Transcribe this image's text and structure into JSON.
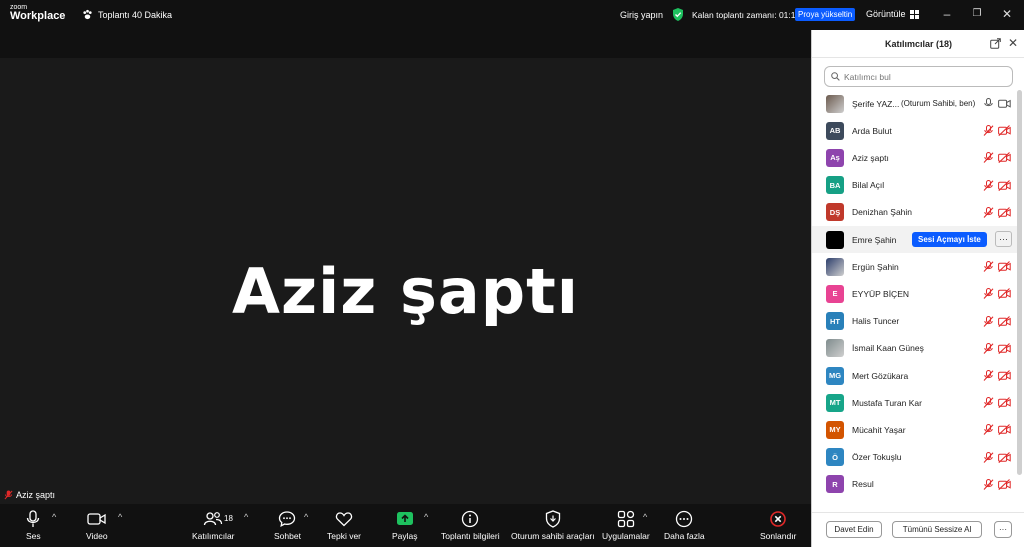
{
  "titlebar": {
    "logo_top": "zoom",
    "logo_bottom": "Workplace",
    "meeting_title": "Toplantı 40 Dakika",
    "signin": "Giriş yapın",
    "remaining": "Kalan toplantı zamanı: 01:16",
    "upgrade": "Proya yükseltin",
    "view": "Görüntüle"
  },
  "video": {
    "active_speaker": "Aziz şaptı",
    "name_tag": "Aziz şaptı"
  },
  "toolbar": {
    "audio": "Ses",
    "video": "Video",
    "participants": "Katılımcılar",
    "participants_count": "18",
    "chat": "Sohbet",
    "react": "Tepki ver",
    "share": "Paylaş",
    "info": "Toplantı bilgileri",
    "host_tools": "Oturum sahibi araçları",
    "apps": "Uygulamalar",
    "more": "Daha fazla",
    "end": "Sonlandır"
  },
  "panel": {
    "title": "Katılımcılar (18)",
    "search_placeholder": "Katılımcı bul",
    "ask_unmute": "Sesi Açmayı İste",
    "more_dots": "···",
    "invite": "Davet Edin",
    "mute_all": "Tümünü Sessize Al",
    "footer_more": "···",
    "participants": [
      {
        "name": "Şerife YAZ...",
        "tag": "(Oturum Sahibi, ben)",
        "initials": "",
        "color": "#6b5a4e",
        "photo": true
      },
      {
        "name": "Arda Bulut",
        "initials": "AB",
        "color": "#3d4a5c"
      },
      {
        "name": "Aziz şaptı",
        "initials": "Aş",
        "color": "#8e44ad"
      },
      {
        "name": "Bilal Açıl",
        "initials": "BA",
        "color": "#16a085"
      },
      {
        "name": "Denizhan Şahin",
        "initials": "DŞ",
        "color": "#c0392b"
      },
      {
        "name": "Emre Şahin",
        "initials": "",
        "color": "#000000",
        "highlight": true
      },
      {
        "name": "Ergün Şahin",
        "initials": "",
        "color": "#2c3e6b",
        "photo": true
      },
      {
        "name": "EYYÜP BİÇEN",
        "initials": "E",
        "color": "#e84393"
      },
      {
        "name": "Halis Tuncer",
        "initials": "HT",
        "color": "#2980b9"
      },
      {
        "name": "İsmail Kaan Güneş",
        "initials": "",
        "color": "#7f8c8d",
        "photo": true
      },
      {
        "name": "Mert Gözükara",
        "initials": "MG",
        "color": "#2e86c1"
      },
      {
        "name": "Mustafa Turan Kar",
        "initials": "MT",
        "color": "#17a589"
      },
      {
        "name": "Mücahit Yaşar",
        "initials": "MY",
        "color": "#d35400"
      },
      {
        "name": "Özer Tokuşlu",
        "initials": "Ö",
        "color": "#2e86c1"
      },
      {
        "name": "Resul",
        "initials": "R",
        "color": "#8e44ad"
      }
    ]
  },
  "colors": {
    "accent": "#0b5cff",
    "muted_icon": "#e02828",
    "share_green": "#1ec15f",
    "end_red": "#e02828"
  }
}
